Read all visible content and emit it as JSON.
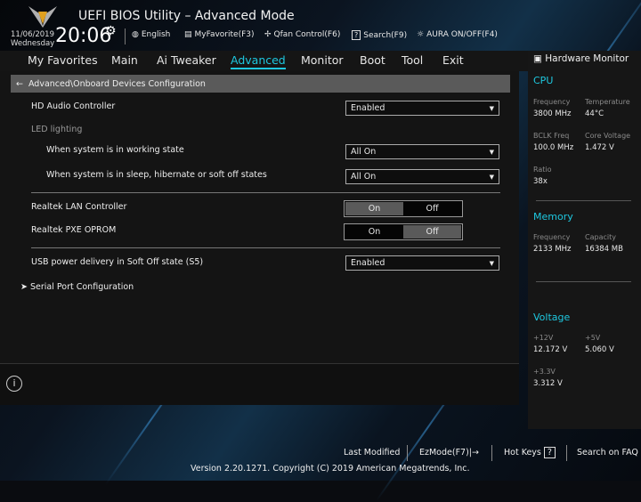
{
  "header": {
    "title": "UEFI BIOS Utility – Advanced Mode",
    "date": "11/06/2019",
    "day": "Wednesday",
    "time": "20:06",
    "tools": [
      {
        "icon": "globe-icon",
        "label": "English"
      },
      {
        "icon": "favorite-icon",
        "label": "MyFavorite(F3)"
      },
      {
        "icon": "fan-icon",
        "label": "Qfan Control(F6)"
      },
      {
        "icon": "search-icon",
        "label": "Search(F9)"
      },
      {
        "icon": "aura-light-icon",
        "label": "AURA ON/OFF(F4)"
      }
    ]
  },
  "nav": {
    "tabs": [
      "My Favorites",
      "Main",
      "Ai Tweaker",
      "Advanced",
      "Monitor",
      "Boot",
      "Tool",
      "Exit"
    ],
    "active": "Advanced"
  },
  "breadcrumb": "Advanced\\Onboard Devices Configuration",
  "settings": {
    "hd_audio": {
      "label": "HD Audio Controller",
      "value": "Enabled"
    },
    "led_lighting": "LED lighting",
    "led_working": {
      "label": "When system is in working state",
      "value": "All On"
    },
    "led_sleep": {
      "label": "When system is in sleep, hibernate or soft off states",
      "value": "All On"
    },
    "lan": {
      "label": "Realtek LAN Controller",
      "on": "On",
      "off": "Off",
      "selected": "On"
    },
    "pxe": {
      "label": "Realtek PXE OPROM",
      "on": "On",
      "off": "Off",
      "selected": "Off"
    },
    "usb_power": {
      "label": "USB power delivery in Soft Off state (S5)",
      "value": "Enabled"
    },
    "serial": "Serial Port Configuration"
  },
  "hw": {
    "title": "Hardware Monitor",
    "cpu": {
      "title": "CPU",
      "freq_l": "Frequency",
      "freq": "3800 MHz",
      "temp_l": "Temperature",
      "temp": "44°C",
      "bclk_l": "BCLK Freq",
      "bclk": "100.0 MHz",
      "cv_l": "Core Voltage",
      "cv": "1.472 V",
      "ratio_l": "Ratio",
      "ratio": "38x"
    },
    "memory": {
      "title": "Memory",
      "freq_l": "Frequency",
      "freq": "2133 MHz",
      "cap_l": "Capacity",
      "cap": "16384 MB"
    },
    "voltage": {
      "title": "Voltage",
      "v12_l": "+12V",
      "v12": "12.172 V",
      "v5_l": "+5V",
      "v5": "5.060 V",
      "v33_l": "+3.3V",
      "v33": "3.312 V"
    }
  },
  "footer": {
    "last_modified": "Last Modified",
    "ezmode": "EzMode(F7)|→",
    "hotkeys": "Hot Keys",
    "hotkeys_icon": "?",
    "faq": "Search on FAQ",
    "version": "Version 2.20.1271. Copyright (C) 2019 American Megatrends, Inc."
  },
  "colors": {
    "accent": "#1ec8e0"
  }
}
